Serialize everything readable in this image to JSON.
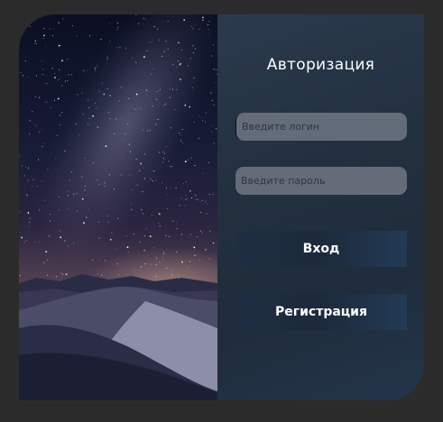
{
  "auth": {
    "title": "Авторизация",
    "login_placeholder": "Введите логин",
    "password_placeholder": "Введите пароль",
    "login_button": "Вход",
    "register_button": "Регистрация"
  },
  "background_image": "night-sky-desert-dunes",
  "colors": {
    "page_background": "#2b2b2b",
    "panel_background": "#22303f",
    "input_background": "#646c79",
    "button_background": "#1e2d40",
    "text": "#ffffff"
  }
}
